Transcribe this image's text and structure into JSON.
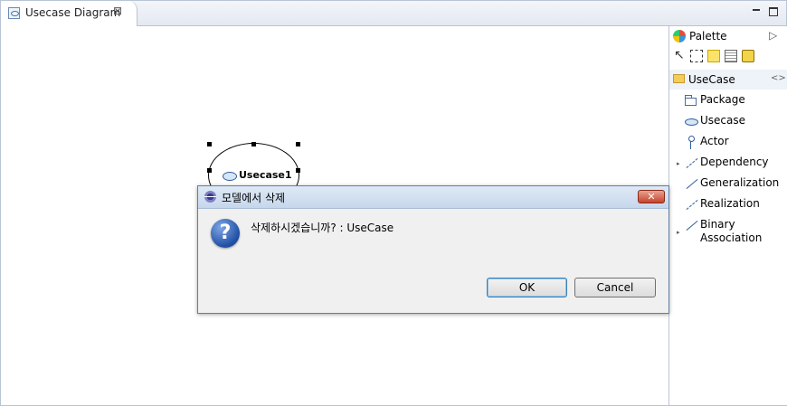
{
  "editor": {
    "tab_title": "Usecase Diagram",
    "tab_close": "⊠"
  },
  "diagram": {
    "usecase_label": "Usecase1"
  },
  "palette": {
    "title": "Palette",
    "expand_glyph": "▷",
    "drawer_label": "UseCase",
    "drawer_pin": "<>",
    "items": [
      {
        "label": "Package",
        "icon": "package-icon"
      },
      {
        "label": "Usecase",
        "icon": "usecase-icon"
      },
      {
        "label": "Actor",
        "icon": "actor-icon"
      },
      {
        "label": "Dependency",
        "icon": "dependency-icon"
      },
      {
        "label": "Generalization",
        "icon": "generalization-icon"
      },
      {
        "label": "Realization",
        "icon": "realization-icon"
      },
      {
        "label": "Binary Association",
        "icon": "binary-association-icon"
      }
    ]
  },
  "dialog": {
    "title": "모델에서 삭제",
    "close_glyph": "✕",
    "question_glyph": "?",
    "message": "삭제하시겠습니까? : UseCase",
    "ok_label": "OK",
    "cancel_label": "Cancel"
  }
}
